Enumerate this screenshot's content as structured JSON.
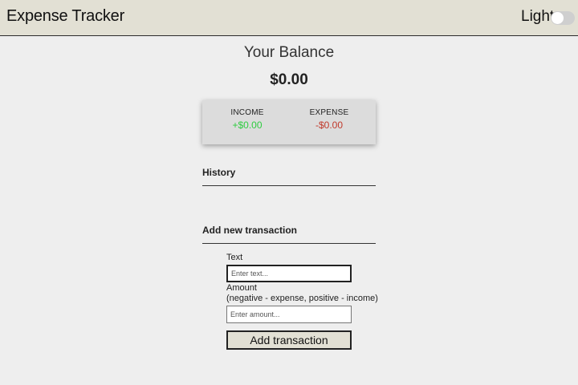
{
  "navbar": {
    "title": "Expense Tracker",
    "theme_label": "Light",
    "theme_toggle_state": "off"
  },
  "balance": {
    "title": "Your Balance",
    "amount": "$0.00"
  },
  "summary": {
    "income_label": "INCOME",
    "income_value": "+$0.00",
    "expense_label": "EXPENSE",
    "expense_value": "-$0.00"
  },
  "history": {
    "heading": "History"
  },
  "form": {
    "heading": "Add new transaction",
    "text_label": "Text",
    "text_placeholder": "Enter text...",
    "amount_label": "Amount",
    "amount_hint": "(negative - expense, positive - income)",
    "amount_placeholder": "Enter amount...",
    "submit_label": "Add transaction"
  },
  "colors": {
    "navbar_bg": "#e2e0d4",
    "page_bg": "#eeeeee",
    "income": "#2ecc40",
    "expense": "#c0392b"
  }
}
